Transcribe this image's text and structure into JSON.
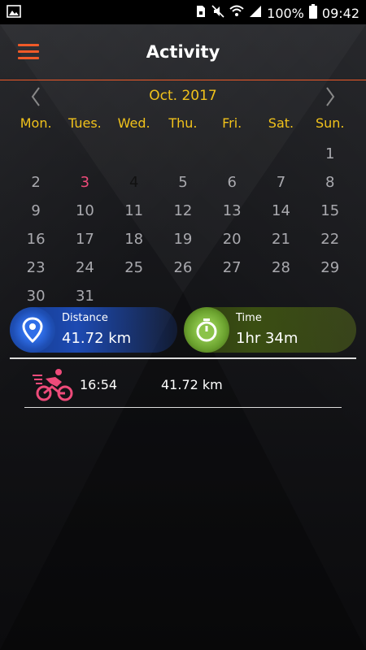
{
  "status_bar": {
    "battery": "100%",
    "time": "09:42"
  },
  "header": {
    "title": "Activity"
  },
  "calendar": {
    "month": "Oct. 2017",
    "weekdays": [
      "Mon.",
      "Tues.",
      "Wed.",
      "Thu.",
      "Fri.",
      "Sat.",
      "Sun."
    ],
    "days": [
      "",
      "",
      "",
      "",
      "",
      "",
      "1",
      "2",
      "3",
      "4",
      "5",
      "6",
      "7",
      "8",
      "9",
      "10",
      "11",
      "12",
      "13",
      "14",
      "15",
      "16",
      "17",
      "18",
      "19",
      "20",
      "21",
      "22",
      "23",
      "24",
      "25",
      "26",
      "27",
      "28",
      "29",
      "30",
      "31",
      "",
      "",
      "",
      "",
      ""
    ],
    "selected_day": "4",
    "highlighted_day": "3",
    "selected_color": "#f05a28",
    "highlight_color": "#ee4b7a",
    "accent_color": "#f1c21b"
  },
  "stats": {
    "distance_label": "Distance",
    "distance_value": "41.72 km",
    "time_label": "Time",
    "time_value": "1hr 34m"
  },
  "activities": [
    {
      "icon": "bike-icon",
      "time": "16:54",
      "distance": "41.72 km"
    }
  ]
}
